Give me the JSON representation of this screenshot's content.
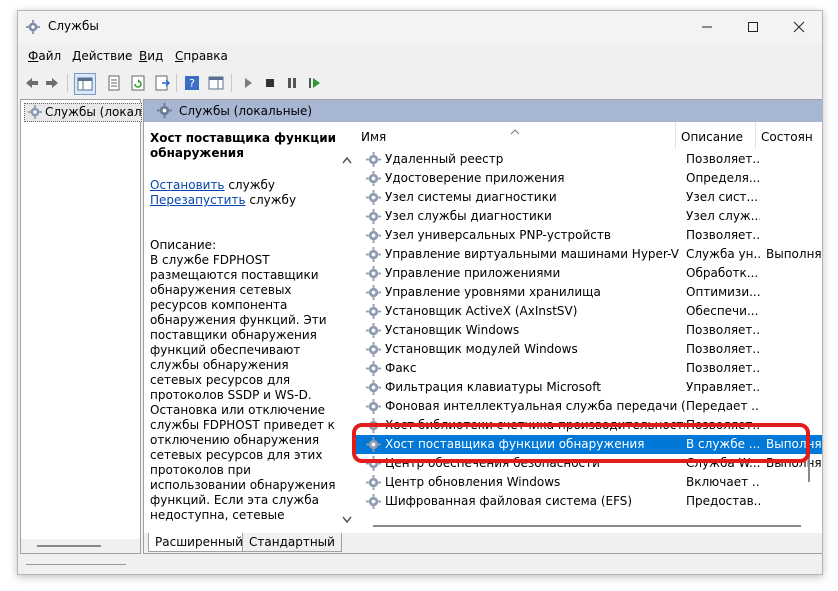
{
  "window": {
    "title": "Службы",
    "minimize_icon": "minimize-icon",
    "maximize_icon": "maximize-icon",
    "close_icon": "close-icon"
  },
  "menu": [
    {
      "label": "Файл",
      "accel": "Ф",
      "rest": "айл"
    },
    {
      "label": "Действие",
      "accel": "Д",
      "rest": "ействие"
    },
    {
      "label": "Вид",
      "accel": "В",
      "rest": "ид"
    },
    {
      "label": "Справка",
      "accel": "С",
      "rest": "правка"
    }
  ],
  "toolbar": {
    "icons": [
      "back-icon",
      "forward-icon",
      "show-tree-icon",
      "properties-icon",
      "refresh-icon",
      "export-icon",
      "help-icon",
      "console-icon",
      "start-icon",
      "stop-icon",
      "pause-icon",
      "restart-icon"
    ]
  },
  "tree": {
    "item": "Службы (локалы"
  },
  "main": {
    "header": "Службы (локальные)",
    "service_name": "Хост поставщика функции обнаружения",
    "stop_link": "Остановить",
    "stop_rest": " службу",
    "restart_link": "Перезапустить",
    "restart_rest": " службу",
    "description_label": "Описание:",
    "description": "В службе FDPHOST размещаются поставщики обнаружения сетевых ресурсов компонента обнаружения функций. Эти поставщики обнаружения функций обеспечивают службы обнаружения сетевых ресурсов для протоколов SSDP и WS-D. Остановка или отключение службы FDPHOST приведет к отключению обнаружения сетевых ресурсов для этих протоколов при использовании обнаружения функций. Если эта служба недоступна, сетевые службы, работа которых зависит от компонента обнаружения функций..."
  },
  "columns": {
    "name": "Имя",
    "description": "Описание",
    "status": "Состоян"
  },
  "services": [
    {
      "name": "Удаленный реестр",
      "desc": "Позволяет...",
      "status": ""
    },
    {
      "name": "Удостоверение приложения",
      "desc": "Определя...",
      "status": ""
    },
    {
      "name": "Узел системы диагностики",
      "desc": "Узел сист...",
      "status": ""
    },
    {
      "name": "Узел службы диагностики",
      "desc": "Узел служ...",
      "status": ""
    },
    {
      "name": "Узел универсальных PNP-устройств",
      "desc": "Позволяет...",
      "status": ""
    },
    {
      "name": "Управление виртуальными машинами Hyper-V",
      "desc": "Служба ун...",
      "status": "Выполня"
    },
    {
      "name": "Управление приложениями",
      "desc": "Обработк...",
      "status": ""
    },
    {
      "name": "Управление уровнями хранилища",
      "desc": "Оптимизи...",
      "status": ""
    },
    {
      "name": "Установщик ActiveX (AxInstSV)",
      "desc": "Обеспечи...",
      "status": ""
    },
    {
      "name": "Установщик Windows",
      "desc": "Позволяет...",
      "status": ""
    },
    {
      "name": "Установщик модулей Windows",
      "desc": "Позволяет...",
      "status": ""
    },
    {
      "name": "Факс",
      "desc": "Позволяет...",
      "status": ""
    },
    {
      "name": "Фильтрация клавиатуры Microsoft",
      "desc": "Управляет...",
      "status": ""
    },
    {
      "name": "Фоновая интеллектуальная служба передачи (BITS)",
      "desc": "Передает ...",
      "status": ""
    },
    {
      "name": "Хост библиотеки счетчика производительности",
      "desc": "Позволяет...",
      "status": ""
    },
    {
      "name": "Хост поставщика функции обнаружения",
      "desc": "В службе ...",
      "status": "Выполня",
      "selected": true
    },
    {
      "name": "Центр обеспечения безопасности",
      "desc": "Служба W...",
      "status": "Выполня"
    },
    {
      "name": "Центр обновления Windows",
      "desc": "Включает ...",
      "status": ""
    },
    {
      "name": "Шифрованная файловая система (EFS)",
      "desc": "Предостав...",
      "status": ""
    }
  ],
  "tabs": [
    "Расширенный",
    "Стандартный"
  ],
  "colors": {
    "selection": "#0078d7",
    "highlight": "#e21b1b",
    "header": "#a7b6d2",
    "link": "#0645ad"
  }
}
